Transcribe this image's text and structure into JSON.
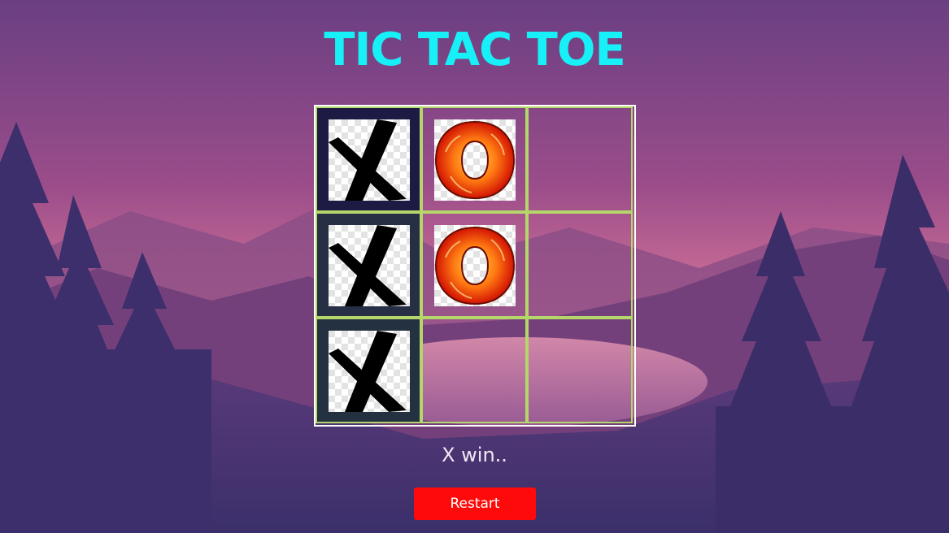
{
  "title": "TIC TAC TOE",
  "status_text": "X win..",
  "restart_label": "Restart",
  "board": [
    [
      "X",
      "O",
      ""
    ],
    [
      "X",
      "O",
      ""
    ],
    [
      "X",
      "",
      ""
    ]
  ],
  "colors": {
    "title": "#17f0f7",
    "grid_line": "#b5d66a",
    "board_border": "#ffffff",
    "restart_button": "#ff0a0a",
    "winning_cells": "#1d1a44"
  },
  "icons": {
    "x_piece": "x-mark-icon",
    "o_piece": "fire-o-icon"
  }
}
